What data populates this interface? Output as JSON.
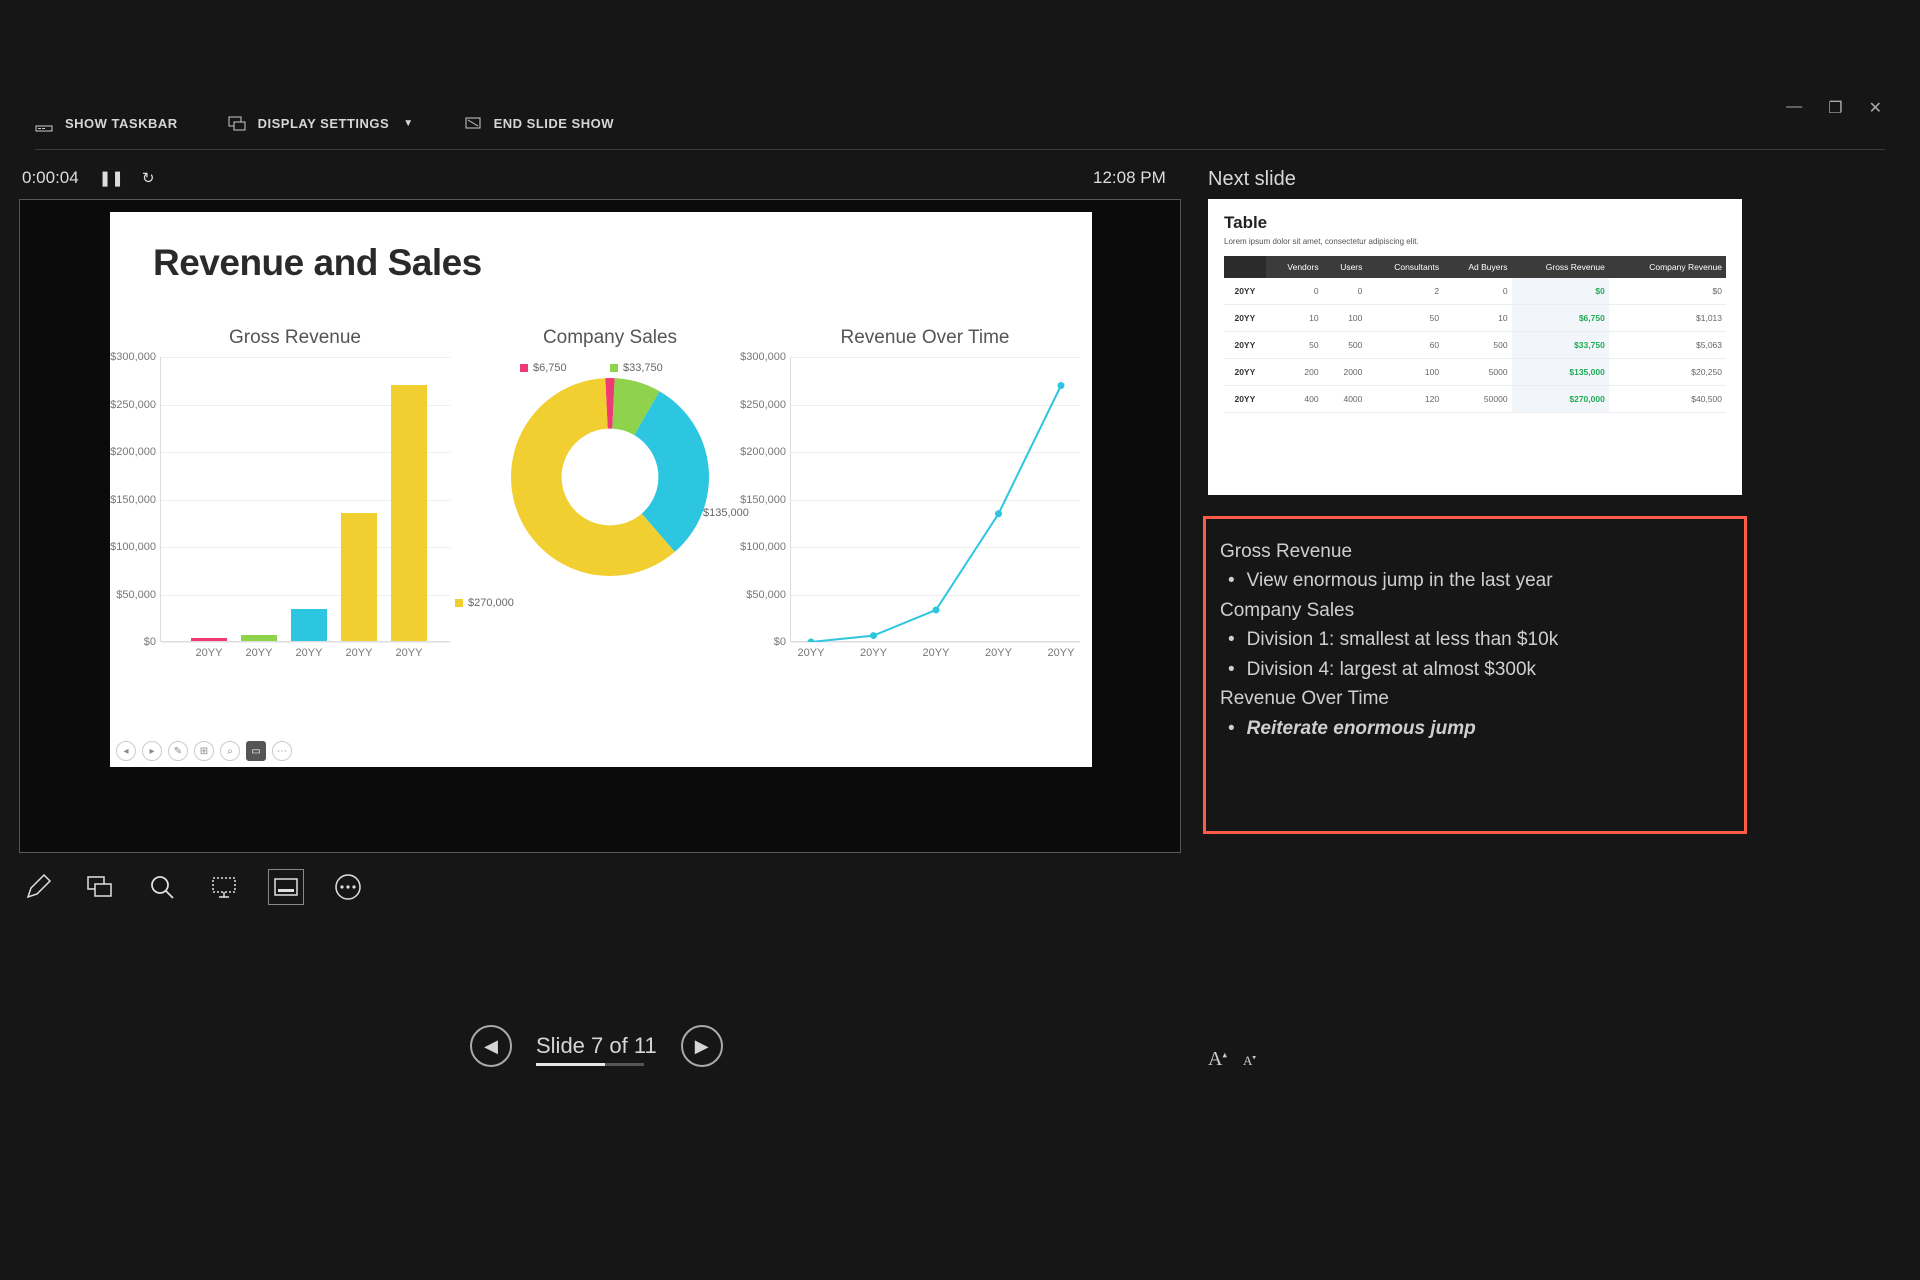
{
  "toolbar": {
    "show_taskbar": "SHOW TASKBAR",
    "display_settings": "DISPLAY SETTINGS",
    "end_show": "END SLIDE SHOW"
  },
  "timer": {
    "elapsed": "0:00:04"
  },
  "clock": "12:08 PM",
  "next_label": "Next slide",
  "slide": {
    "title": "Revenue and Sales",
    "bar": {
      "title": "Gross Revenue",
      "yticks": [
        "$0",
        "$50,000",
        "$100,000",
        "$150,000",
        "$200,000",
        "$250,000",
        "$300,000"
      ],
      "xcat": "20YY"
    },
    "donut": {
      "title": "Company Sales",
      "labels": {
        "pink": "$6,750",
        "green": "$33,750",
        "cyan": "$135,000",
        "yellow": "$270,000"
      }
    },
    "line": {
      "title": "Revenue Over Time",
      "yticks": [
        "$0",
        "$50,000",
        "$100,000",
        "$150,000",
        "$200,000",
        "$250,000",
        "$300,000"
      ],
      "xcat": "20YY"
    }
  },
  "chart_data": [
    {
      "type": "bar",
      "title": "Gross Revenue",
      "categories": [
        "20YY",
        "20YY",
        "20YY",
        "20YY",
        "20YY"
      ],
      "values": [
        50,
        6750,
        33750,
        135000,
        270000
      ],
      "ylim": [
        0,
        300000
      ],
      "colors": [
        "#ef3b72",
        "#8fd34d",
        "#2cc6e0",
        "#f2cf30",
        "#f2cf30"
      ]
    },
    {
      "type": "pie",
      "title": "Company Sales",
      "series": [
        {
          "name": "$270,000",
          "value": 270000,
          "color": "#f2cf30"
        },
        {
          "name": "$135,000",
          "value": 135000,
          "color": "#2cc6e0"
        },
        {
          "name": "$33,750",
          "value": 33750,
          "color": "#8fd34d"
        },
        {
          "name": "$6,750",
          "value": 6750,
          "color": "#ef3b72"
        }
      ]
    },
    {
      "type": "line",
      "title": "Revenue Over Time",
      "categories": [
        "20YY",
        "20YY",
        "20YY",
        "20YY",
        "20YY"
      ],
      "values": [
        50,
        6750,
        33750,
        135000,
        270000
      ],
      "ylim": [
        0,
        300000
      ],
      "color": "#2cc6e0"
    }
  ],
  "next_slide": {
    "title": "Table",
    "subtitle": "Lorem ipsum dolor sit amet, consectetur adipiscing elit.",
    "headers": [
      "",
      "Vendors",
      "Users",
      "Consultants",
      "Ad Buyers",
      "Gross Revenue",
      "Company Revenue"
    ],
    "rows": [
      [
        "20YY",
        "0",
        "0",
        "2",
        "0",
        "$0",
        "$0"
      ],
      [
        "20YY",
        "10",
        "100",
        "50",
        "10",
        "$6,750",
        "$1,013"
      ],
      [
        "20YY",
        "50",
        "500",
        "60",
        "500",
        "$33,750",
        "$5,063"
      ],
      [
        "20YY",
        "200",
        "2000",
        "100",
        "5000",
        "$135,000",
        "$20,250"
      ],
      [
        "20YY",
        "400",
        "4000",
        "120",
        "50000",
        "$270,000",
        "$40,500"
      ]
    ]
  },
  "notes": {
    "lines": [
      {
        "t": "hdr",
        "text": "Gross Revenue"
      },
      {
        "t": "bul",
        "text": "View enormous jump in the last year"
      },
      {
        "t": "hdr",
        "text": "Company Sales"
      },
      {
        "t": "bul",
        "text": "Division 1: smallest at less than $10k"
      },
      {
        "t": "bul",
        "text": "Division 4: largest at almost $300k"
      },
      {
        "t": "hdr",
        "text": "Revenue Over Time"
      },
      {
        "t": "bul",
        "text": "Reiterate enormous jump",
        "em": true
      }
    ]
  },
  "nav": {
    "label": "Slide 7 of 11",
    "current": 7,
    "total": 11
  }
}
